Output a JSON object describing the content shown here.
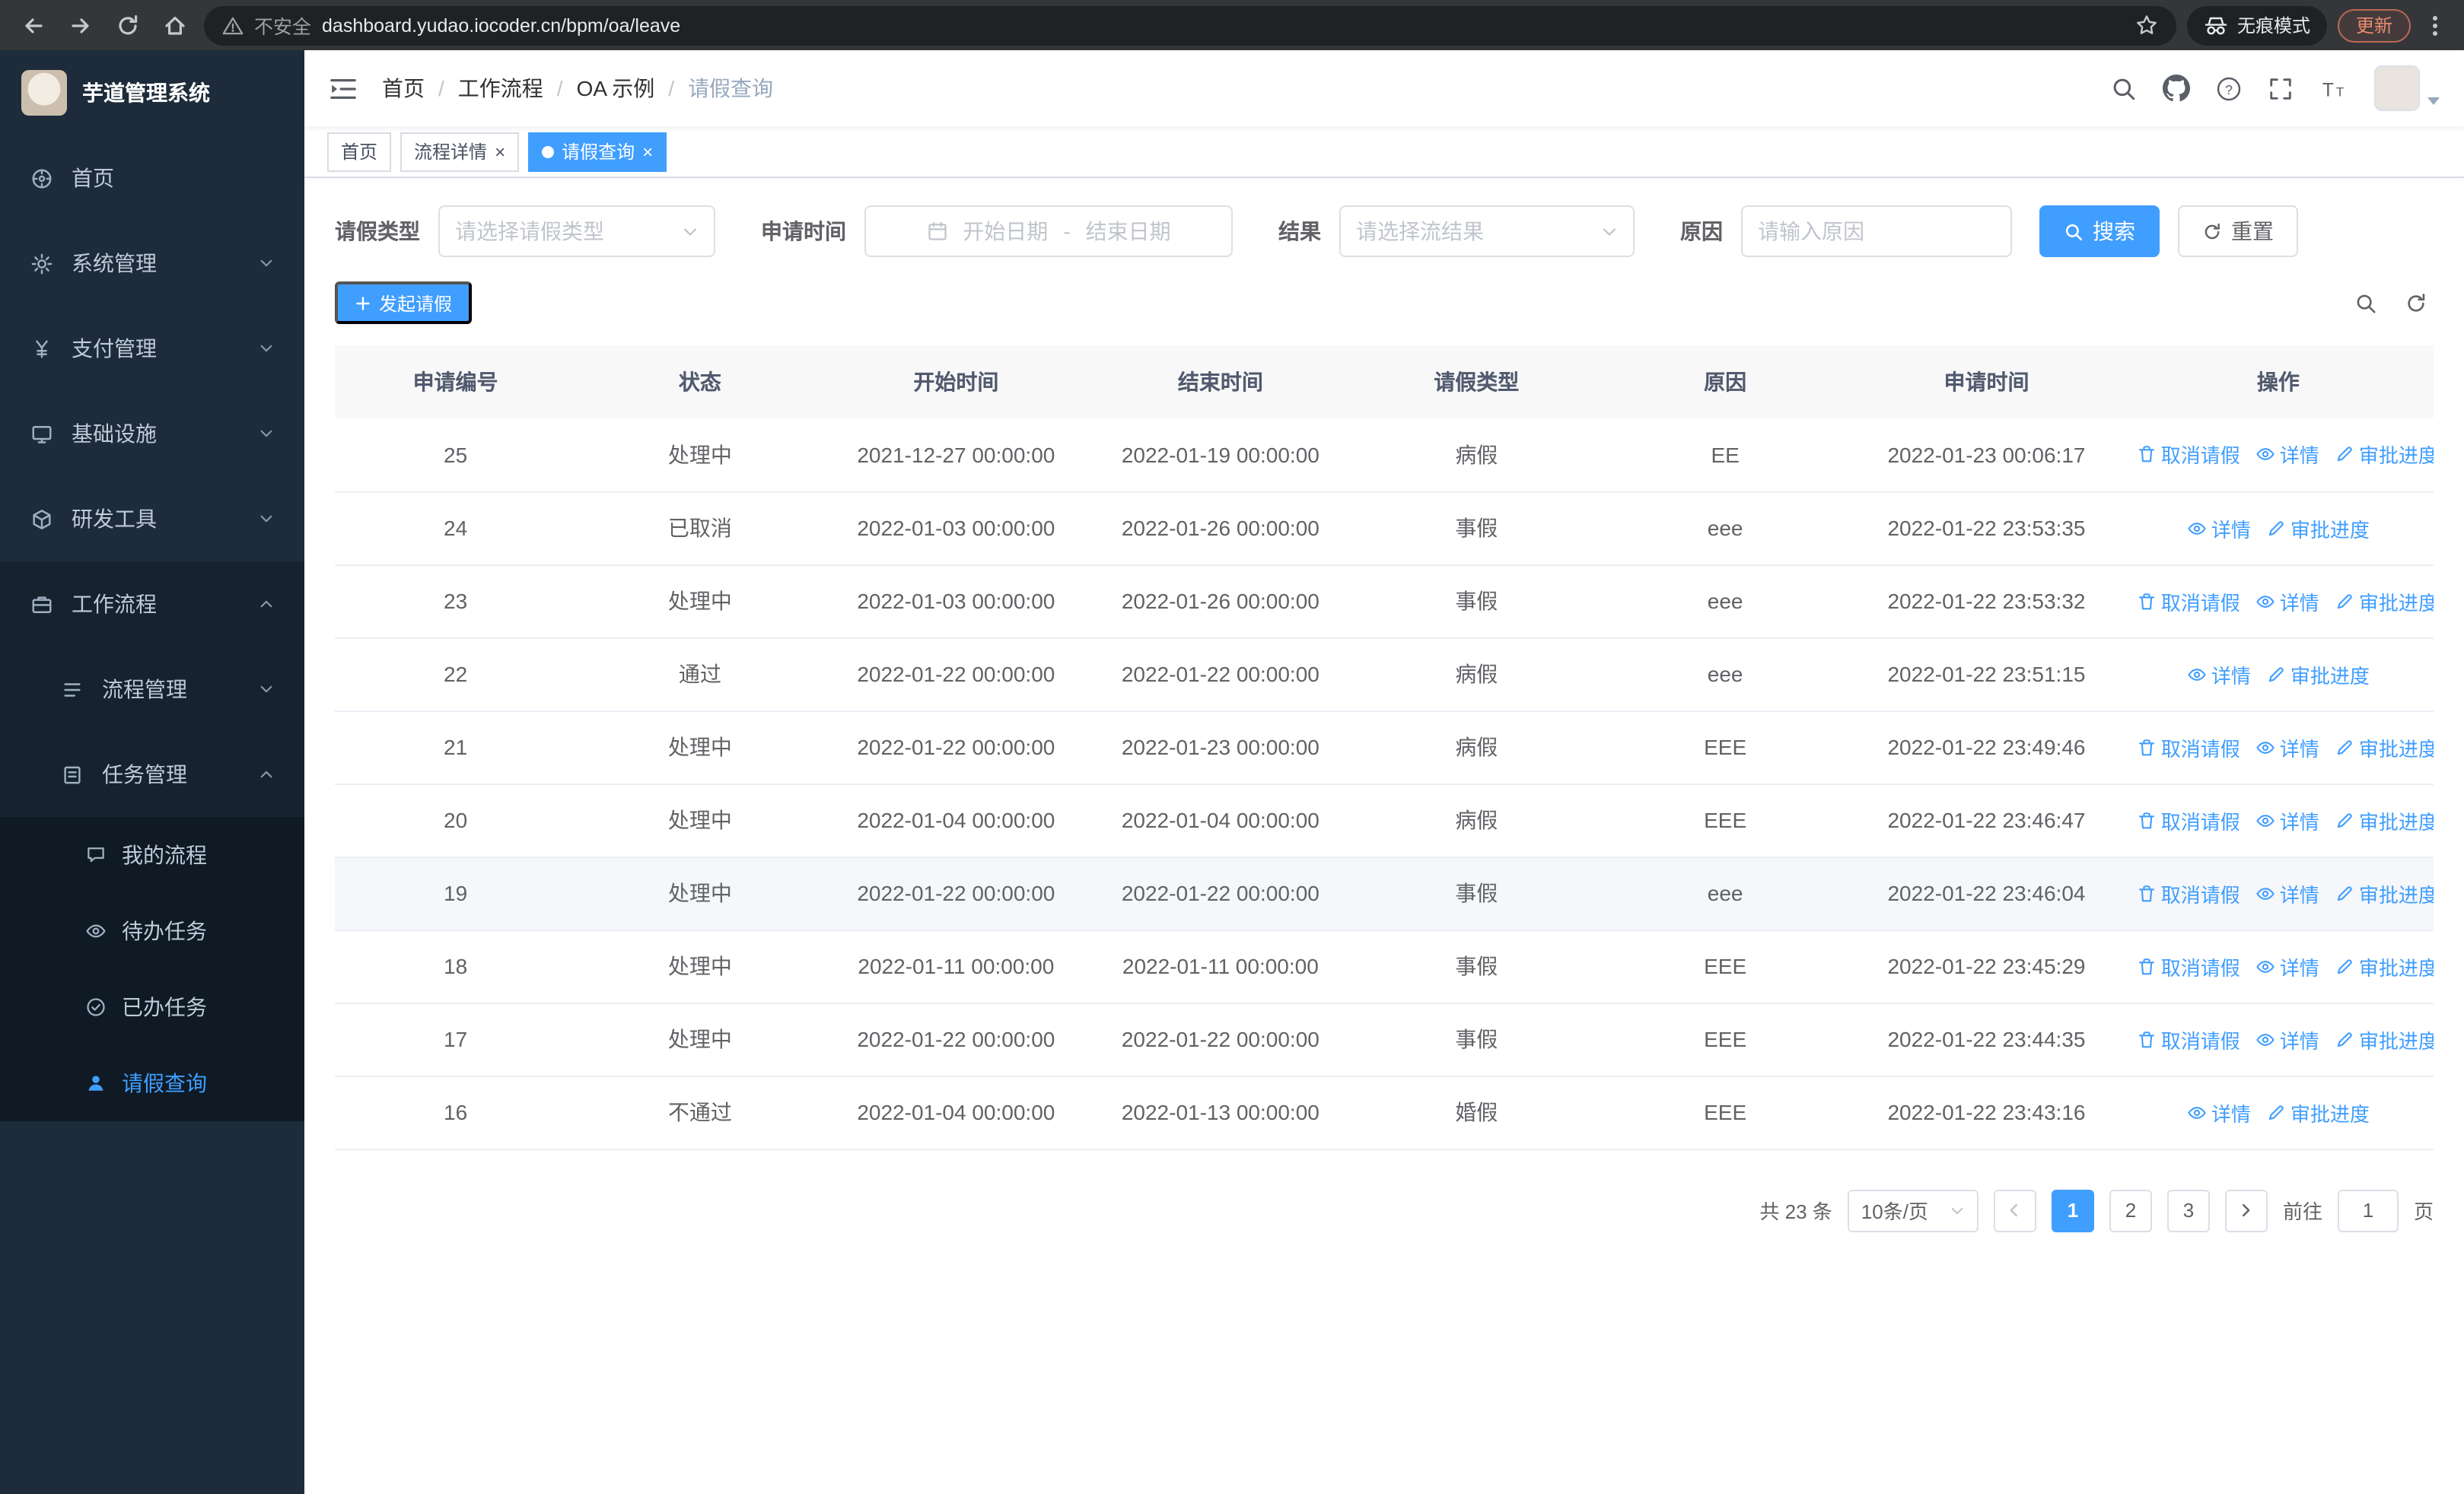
{
  "browser": {
    "security_label": "不安全",
    "url": "dashboard.yudao.iocoder.cn/bpm/oa/leave",
    "incognito_label": "无痕模式",
    "update_label": "更新"
  },
  "sidebar": {
    "logo_title": "芋道管理系统",
    "items": [
      {
        "label": "首页",
        "icon": "dashboard-icon"
      },
      {
        "label": "系统管理",
        "icon": "gear-icon"
      },
      {
        "label": "支付管理",
        "icon": "payment-icon"
      },
      {
        "label": "基础设施",
        "icon": "infrastructure-icon"
      },
      {
        "label": "研发工具",
        "icon": "devtools-icon"
      },
      {
        "label": "工作流程",
        "icon": "workflow-icon",
        "expanded": true
      },
      {
        "label": "流程管理",
        "icon": "process-icon"
      },
      {
        "label": "任务管理",
        "icon": "task-icon",
        "expanded": true
      },
      {
        "label": "我的流程",
        "icon": "my-process-icon"
      },
      {
        "label": "待办任务",
        "icon": "todo-icon"
      },
      {
        "label": "已办任务",
        "icon": "done-icon"
      },
      {
        "label": "请假查询",
        "icon": "leave-icon",
        "active": true
      }
    ]
  },
  "breadcrumb": {
    "items": [
      "首页",
      "工作流程",
      "OA 示例",
      "请假查询"
    ]
  },
  "tabs": [
    {
      "label": "首页",
      "closable": false,
      "active": false
    },
    {
      "label": "流程详情",
      "closable": true,
      "active": false
    },
    {
      "label": "请假查询",
      "closable": true,
      "active": true
    }
  ],
  "filters": {
    "leave_type_label": "请假类型",
    "leave_type_placeholder": "请选择请假类型",
    "apply_time_label": "申请时间",
    "start_date_placeholder": "开始日期",
    "range_separator": "-",
    "end_date_placeholder": "结束日期",
    "result_label": "结果",
    "result_placeholder": "请选择流结果",
    "reason_label": "原因",
    "reason_placeholder": "请输入原因",
    "search_label": "搜索",
    "reset_label": "重置"
  },
  "toolbar": {
    "create_label": "发起请假"
  },
  "table": {
    "columns": [
      "申请编号",
      "状态",
      "开始时间",
      "结束时间",
      "请假类型",
      "原因",
      "申请时间",
      "操作"
    ],
    "action_labels": {
      "cancel": "取消请假",
      "detail": "详情",
      "progress": "审批进度"
    },
    "rows": [
      {
        "id": "25",
        "status": "处理中",
        "start": "2021-12-27 00:00:00",
        "end": "2022-01-19 00:00:00",
        "type": "病假",
        "reason": "EE",
        "applied": "2022-01-23 00:06:17",
        "actions": [
          "cancel",
          "detail",
          "progress"
        ]
      },
      {
        "id": "24",
        "status": "已取消",
        "start": "2022-01-03 00:00:00",
        "end": "2022-01-26 00:00:00",
        "type": "事假",
        "reason": "eee",
        "applied": "2022-01-22 23:53:35",
        "actions": [
          "detail",
          "progress"
        ]
      },
      {
        "id": "23",
        "status": "处理中",
        "start": "2022-01-03 00:00:00",
        "end": "2022-01-26 00:00:00",
        "type": "事假",
        "reason": "eee",
        "applied": "2022-01-22 23:53:32",
        "actions": [
          "cancel",
          "detail",
          "progress"
        ]
      },
      {
        "id": "22",
        "status": "通过",
        "start": "2022-01-22 00:00:00",
        "end": "2022-01-22 00:00:00",
        "type": "病假",
        "reason": "eee",
        "applied": "2022-01-22 23:51:15",
        "actions": [
          "detail",
          "progress"
        ]
      },
      {
        "id": "21",
        "status": "处理中",
        "start": "2022-01-22 00:00:00",
        "end": "2022-01-23 00:00:00",
        "type": "病假",
        "reason": "EEE",
        "applied": "2022-01-22 23:49:46",
        "actions": [
          "cancel",
          "detail",
          "progress"
        ]
      },
      {
        "id": "20",
        "status": "处理中",
        "start": "2022-01-04 00:00:00",
        "end": "2022-01-04 00:00:00",
        "type": "病假",
        "reason": "EEE",
        "applied": "2022-01-22 23:46:47",
        "actions": [
          "cancel",
          "detail",
          "progress"
        ]
      },
      {
        "id": "19",
        "status": "处理中",
        "start": "2022-01-22 00:00:00",
        "end": "2022-01-22 00:00:00",
        "type": "事假",
        "reason": "eee",
        "applied": "2022-01-22 23:46:04",
        "actions": [
          "cancel",
          "detail",
          "progress"
        ],
        "highlight": true
      },
      {
        "id": "18",
        "status": "处理中",
        "start": "2022-01-11 00:00:00",
        "end": "2022-01-11 00:00:00",
        "type": "事假",
        "reason": "EEE",
        "applied": "2022-01-22 23:45:29",
        "actions": [
          "cancel",
          "detail",
          "progress"
        ]
      },
      {
        "id": "17",
        "status": "处理中",
        "start": "2022-01-22 00:00:00",
        "end": "2022-01-22 00:00:00",
        "type": "事假",
        "reason": "EEE",
        "applied": "2022-01-22 23:44:35",
        "actions": [
          "cancel",
          "detail",
          "progress"
        ]
      },
      {
        "id": "16",
        "status": "不通过",
        "start": "2022-01-04 00:00:00",
        "end": "2022-01-13 00:00:00",
        "type": "婚假",
        "reason": "EEE",
        "applied": "2022-01-22 23:43:16",
        "actions": [
          "detail",
          "progress"
        ]
      }
    ]
  },
  "pagination": {
    "total_label": "共 23 条",
    "page_size_label": "10条/页",
    "pages": [
      "1",
      "2",
      "3"
    ],
    "current_page": "1",
    "goto_label": "前往",
    "goto_value": "1",
    "unit_label": "页"
  }
}
